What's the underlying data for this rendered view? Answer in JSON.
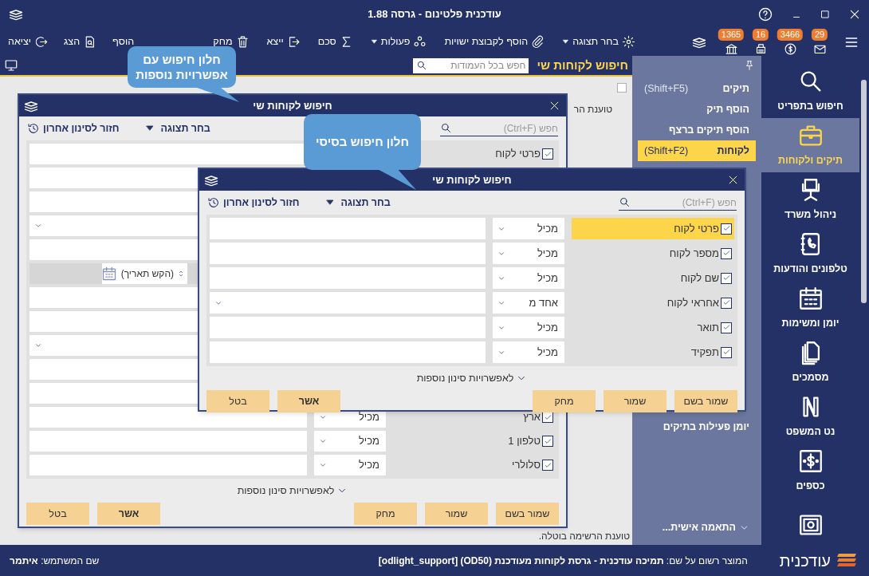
{
  "window": {
    "title": "עודכנית פלטינום - גרסה 1.88"
  },
  "toolbar": {
    "indicators": [
      {
        "kind": "mail",
        "count": "29"
      },
      {
        "kind": "coin",
        "count": "3466"
      },
      {
        "kind": "print",
        "count": "16"
      },
      {
        "kind": "bank",
        "count": "1365"
      }
    ],
    "actions": [
      {
        "kind": "gear",
        "label": "בחר תצוגה",
        "menu": true
      },
      {
        "kind": "clip",
        "label": "הוסף לקבוצת ישויות",
        "menu": false
      },
      {
        "kind": "nodes",
        "label": "פעולות",
        "menu": true
      },
      {
        "kind": "sigma",
        "label": "סכם",
        "menu": false
      },
      {
        "kind": "export",
        "label": "ייצא",
        "menu": false
      },
      {
        "kind": "trash",
        "label": "מחק",
        "menu": false
      }
    ],
    "end_actions": [
      {
        "kind": "none",
        "label": "הוסף",
        "menu": false
      },
      {
        "kind": "view",
        "label": "הצג",
        "menu": false
      },
      {
        "kind": "exit",
        "label": "יציאה",
        "menu": false
      }
    ]
  },
  "list_view": {
    "title": "חיפוש לקוחות שי",
    "search": {
      "placeholder": "חפש בכל העמודות"
    },
    "select_all": {
      "checked": false
    },
    "texts": [
      "טוענת הר",
      "טוענת הרשימה בוטלה."
    ]
  },
  "sidebar": {
    "items": [
      {
        "label": "תיקים",
        "shortcut": "(Shift+F5)",
        "selected": false
      },
      {
        "label": "הוסף תיק",
        "selected": false
      },
      {
        "label": "הוסף תיקים ברצף",
        "selected": false
      },
      {
        "label": "לקוחות",
        "shortcut": "(Shift+F2)",
        "selected": true
      }
    ],
    "lower_items": [
      {
        "label": "יומן פעילות בתיקים"
      }
    ],
    "customize": "התאמה אישית..."
  },
  "nav": [
    {
      "kind": "search",
      "label": "חיפוש בתפריט",
      "selected": false
    },
    {
      "kind": "briefcase",
      "label": "תיקים ולקוחות",
      "selected": true
    },
    {
      "kind": "chair",
      "label": "ניהול משרד",
      "selected": false
    },
    {
      "kind": "phonebook",
      "label": "טלפונים והודעות",
      "selected": false
    },
    {
      "kind": "calendar",
      "label": "יומן ומשימות",
      "selected": false
    },
    {
      "kind": "documents",
      "label": "מסמכים",
      "selected": false
    },
    {
      "kind": "nlogo",
      "label": "נט המשפט",
      "selected": false
    },
    {
      "kind": "money",
      "label": "כספים",
      "selected": false
    },
    {
      "kind": "safe",
      "selected": false
    }
  ],
  "dialogs": [
    {
      "title": "חיפוש לקוחות שי",
      "search_placeholder": "חפש (Ctrl+F)",
      "view_label": "בחר תצוגה",
      "restore_label": "חזור לסינון אחרון",
      "rows": [
        {
          "label": "פרטי לקוח",
          "checked": true,
          "selected": false,
          "kind": "text"
        },
        {
          "kind": "text"
        },
        {
          "kind": "text"
        },
        {
          "kind": "dropdown"
        },
        {
          "kind": "text"
        },
        {
          "kind": "date",
          "placeholder": "(הקש תאריך)"
        },
        {
          "kind": "text"
        },
        {
          "kind": "text"
        },
        {
          "kind": "dropdown"
        },
        {
          "kind": "text"
        },
        {
          "kind": "text"
        },
        {
          "label": "ארץ",
          "checked": true,
          "selected": false,
          "operator": "מכיל",
          "kind": "text"
        },
        {
          "label": "טלפון 1",
          "checked": true,
          "selected": false,
          "operator": "מכיל",
          "kind": "text"
        },
        {
          "label": "סלולרי",
          "checked": true,
          "selected": false,
          "operator": "מכיל",
          "kind": "text"
        }
      ],
      "more_label": "לאפשרויות סינון נוספות",
      "actions": [
        "שמור בשם",
        "שמור",
        "מחק"
      ],
      "confirm": [
        {
          "label": "אשר",
          "default": true
        },
        {
          "label": "בטל",
          "default": false
        }
      ]
    },
    {
      "title": "חיפוש לקוחות שי",
      "search_placeholder": "חפש (Ctrl+F)",
      "view_label": "בחר תצוגה",
      "restore_label": "חזור לסינון אחרון",
      "rows": [
        {
          "label": "פרטי לקוח",
          "checked": true,
          "selected": true,
          "operator": "מכיל",
          "kind": "text"
        },
        {
          "label": "מספר לקוח",
          "checked": true,
          "selected": false,
          "operator": "מכיל",
          "kind": "text"
        },
        {
          "label": "שם לקוח",
          "checked": true,
          "selected": false,
          "operator": "מכיל",
          "kind": "text"
        },
        {
          "label": "אחראי לקוח",
          "checked": true,
          "selected": false,
          "operator": "אחד מ",
          "kind": "dropdown"
        },
        {
          "label": "תואר",
          "checked": true,
          "selected": false,
          "operator": "מכיל",
          "kind": "text"
        },
        {
          "label": "תפקיד",
          "checked": true,
          "selected": false,
          "operator": "מכיל",
          "kind": "text"
        }
      ],
      "more_label": "לאפשרויות סינון נוספות",
      "actions": [
        "שמור בשם",
        "שמור",
        "מחק"
      ],
      "confirm": [
        {
          "label": "אשר",
          "default": true
        },
        {
          "label": "בטל",
          "default": false
        }
      ]
    }
  ],
  "callouts": [
    {
      "text": "חלון חיפוש עם אפשרויות נוספות"
    },
    {
      "text": "חלון חיפוש בסיסי"
    }
  ],
  "status_bar": {
    "brand": "עודכנית",
    "registration": "המוצר רשום על שם: **תמיכה עודכנית - גרסת לקוחות מעודכנת (OD50) [odlight_support]**",
    "user": "שם המשתמש: **איתמר**"
  }
}
